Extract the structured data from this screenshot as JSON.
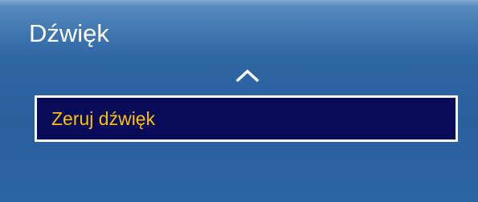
{
  "menu": {
    "title": "Dźwięk",
    "items": [
      {
        "label": "Zeruj dźwięk",
        "selected": true
      }
    ],
    "up_icon": "chevron-up-icon"
  },
  "colors": {
    "panel_bg": "#2f66a4",
    "selected_bg": "#070b5a",
    "selected_text": "#ffc000",
    "title_text": "#ffffff"
  }
}
